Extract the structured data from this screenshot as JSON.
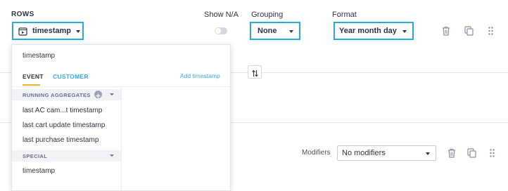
{
  "rows": {
    "header": "ROWS",
    "selected": "timestamp"
  },
  "show_na": {
    "label": "Show N/A"
  },
  "grouping": {
    "label": "Grouping",
    "value": "None"
  },
  "format": {
    "label": "Format",
    "value": "Year month day"
  },
  "dropdown": {
    "search_value": "timestamp",
    "tabs": [
      "EVENT",
      "CUSTOMER"
    ],
    "add_link": "Add timestamp",
    "sections": [
      {
        "label": "RUNNING AGGREGATES",
        "items": [
          "last AC cam...t timestamp",
          "last cart update timestamp",
          "last purchase timestamp"
        ]
      },
      {
        "label": "SPECIAL",
        "items": [
          "timestamp"
        ]
      }
    ]
  },
  "modifiers": {
    "label": "Modifiers",
    "value": "No modifiers"
  },
  "colors": {
    "accent": "#2aa7df",
    "tab_underline": "#e8b628",
    "link": "#3aa9d8"
  }
}
